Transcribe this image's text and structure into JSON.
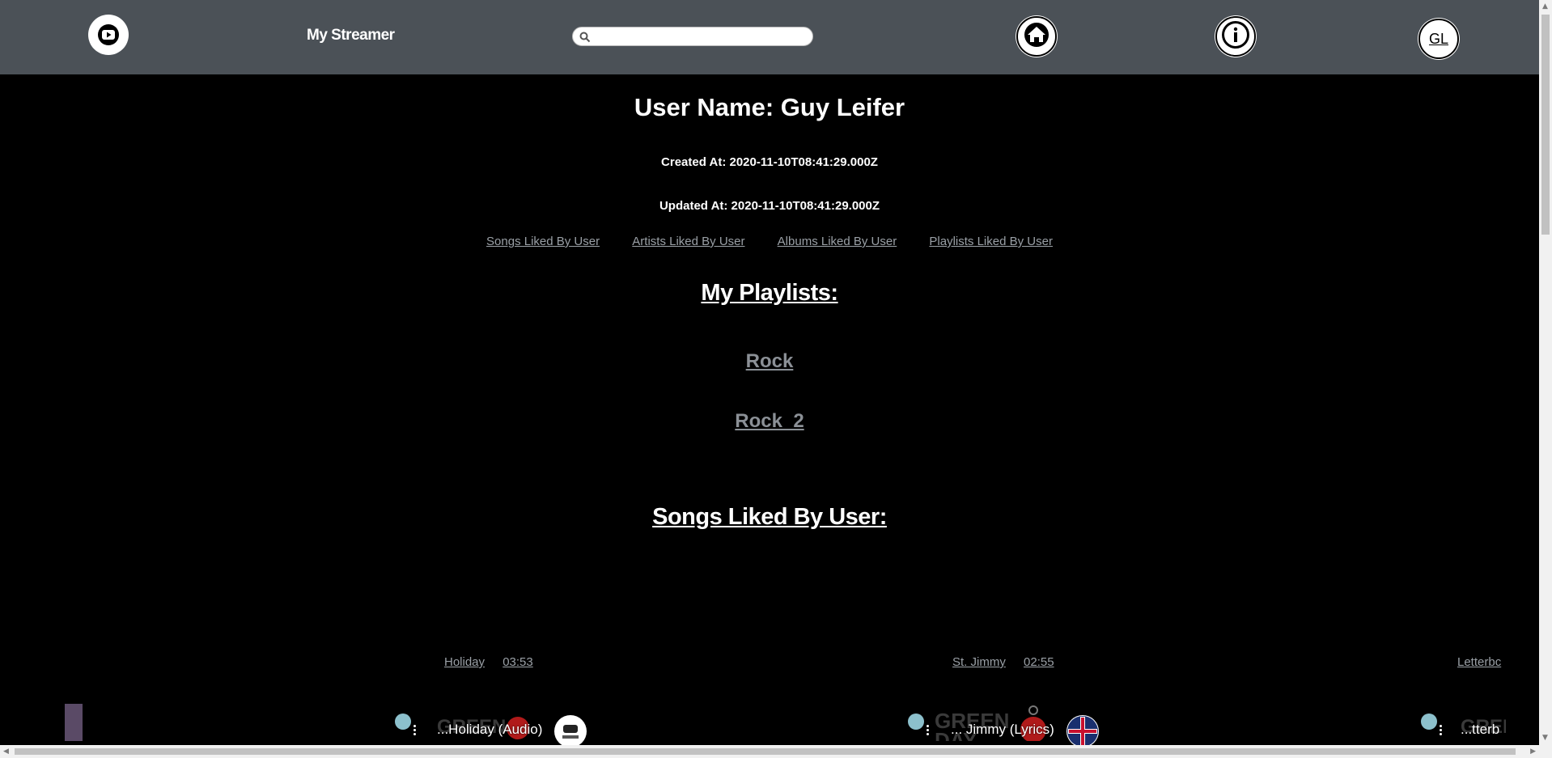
{
  "header": {
    "brand": "My Streamer",
    "search_placeholder": "",
    "avatar_initials": "GL"
  },
  "profile": {
    "user_name": "User Name: Guy Leifer",
    "created_at": "Created At: 2020-11-10T08:41:29.000Z",
    "updated_at": "Updated At: 2020-11-10T08:41:29.000Z"
  },
  "liked_links": [
    "Songs Liked By User",
    "Artists Liked By User",
    "Albums Liked By User",
    "Playlists Liked By User"
  ],
  "playlists_title": "My Playlists:",
  "playlists": [
    "Rock",
    "Rock_2"
  ],
  "songs_title": "Songs Liked By User:",
  "songs": [
    {
      "title": "Holiday",
      "duration": "03:53",
      "video_caption": "...Holiday (Audio)"
    },
    {
      "title": "St. Jimmy",
      "duration": "02:55",
      "video_caption": "... Jimmy (Lyrics)"
    },
    {
      "title": "Letterbc",
      "duration": "",
      "video_caption": "...tterb"
    }
  ],
  "icons": {
    "logo": "play-circle-icon",
    "search": "search-icon",
    "home": "home-icon",
    "info": "info-icon"
  },
  "colors": {
    "header_bg": "#4b5157",
    "page_bg": "#000000",
    "link_muted": "#9aa0a6"
  }
}
